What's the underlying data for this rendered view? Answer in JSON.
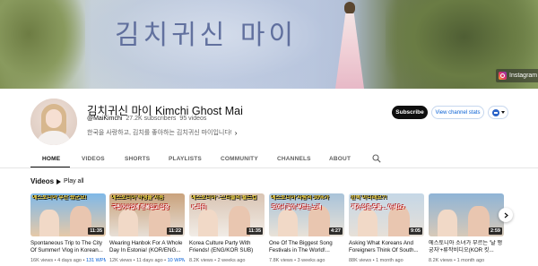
{
  "banner": {
    "title": "김치귀신 마이",
    "links": [
      {
        "label": "Instagram",
        "icon": "instagram-icon"
      }
    ]
  },
  "channel": {
    "name": "김치귀신 마이 Kimchi Ghost Mai",
    "handle": "@MaiKimchi",
    "subscribers": "27.2K subscribers",
    "videos": "95 videos",
    "description": "한국을 사랑하고, 김치를 좋아하는 김치귀신 마이입니다!",
    "more_icon": "chevron-right-icon"
  },
  "actions": {
    "subscribe": "Subscribe",
    "stats": "View channel stats",
    "chip_icon": "korea-flag-icon"
  },
  "tabs": [
    {
      "label": "HOME",
      "active": true
    },
    {
      "label": "VIDEOS"
    },
    {
      "label": "SHORTS"
    },
    {
      "label": "PLAYLISTS"
    },
    {
      "label": "COMMUNITY"
    },
    {
      "label": "CHANNELS"
    },
    {
      "label": "ABOUT"
    }
  ],
  "shelf": {
    "title": "Videos",
    "play_all": "Play all"
  },
  "videos": [
    {
      "caption": "에스토니아 부산 왔군요!",
      "caption2": "",
      "duration": "11:35",
      "title": "Spontaneous Trip to The City Of Summer! Vlog in Korean...",
      "views": "16K views",
      "age": "4 days ago",
      "extra": "131 WPM",
      "colors": [
        "#7fb8e8",
        "#e6c9a8"
      ]
    },
    {
      "caption": "에스토니아 학생들 처음",
      "caption2": "국립어사업에 한복입고 입장",
      "duration": "11:22",
      "title": "Wearing Hanbok For A Whole Day In Estonia! (KOR/ENG...",
      "views": "12K views",
      "age": "11 days ago",
      "extra": "10 WPM",
      "colors": [
        "#c9a27c",
        "#e7dfd6"
      ]
    },
    {
      "caption": "에스토니아 - 스티플의 월드컵",
      "caption2": "K-파티",
      "duration": "11:35",
      "title": "Korea Culture Party With Friends! (ENG/KOR SUB)",
      "views": "8.2K views",
      "age": "2 weeks ago",
      "extra": "",
      "colors": [
        "#d9c4b3",
        "#f1ece6"
      ]
    },
    {
      "caption": "에스토니아 사람의 30%가",
      "caption2": "모여서 같이 부르는 노래",
      "duration": "4:27",
      "title": "One Of The Biggest Song Festivals in The World!...",
      "views": "7.8K views",
      "age": "3 weeks ago",
      "extra": "",
      "colors": [
        "#a9c3d9",
        "#e9e2d8"
      ]
    },
    {
      "caption": "한복 아니래요?!",
      "caption2": "제가 입은 옷을 ... 아세요?",
      "duration": "9:05",
      "title": "Asking What Koreans And Foreigners Think Of South...",
      "views": "88K views",
      "age": "1 month ago",
      "extra": "",
      "colors": [
        "#c5d7e6",
        "#e7e0d8"
      ]
    },
    {
      "caption": "",
      "caption2": "",
      "duration": "2:59",
      "title": "에스토니아 소녀가 부르는 '날 행궁자'+류작비디오(KOR 킷...",
      "views": "8.2K views",
      "age": "1 month ago",
      "extra": "",
      "colors": [
        "#8fb4d6",
        "#d7c9b8"
      ]
    }
  ]
}
